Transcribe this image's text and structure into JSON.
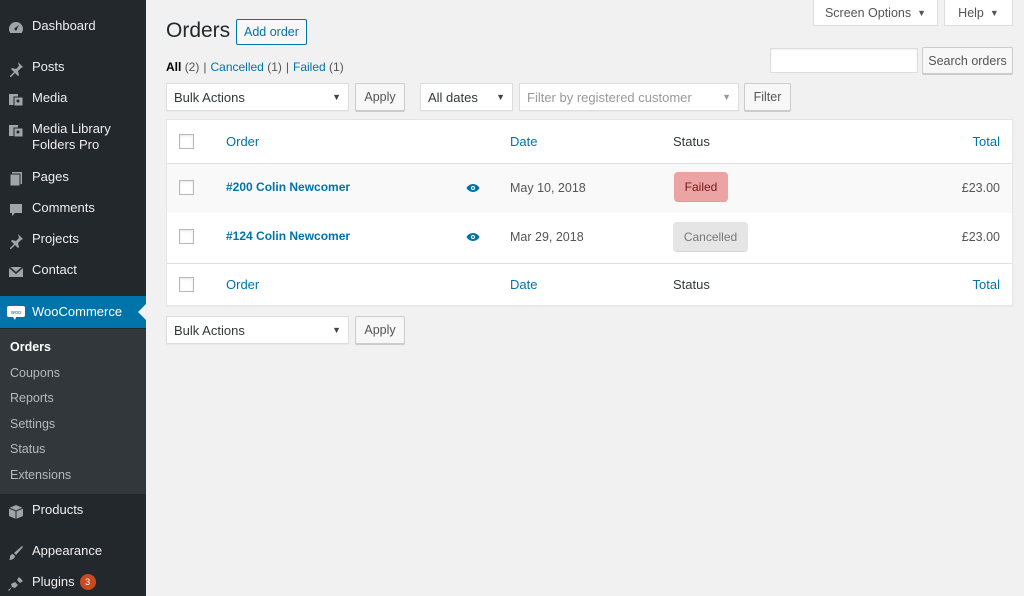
{
  "sidebar": {
    "items": [
      {
        "label": "Dashboard",
        "icon": "dashboard-icon"
      },
      {
        "label": "Posts",
        "icon": "pin-icon"
      },
      {
        "label": "Media",
        "icon": "media-icon"
      },
      {
        "label": "Media Library Folders Pro",
        "icon": "media-icon"
      },
      {
        "label": "Pages",
        "icon": "pages-icon"
      },
      {
        "label": "Comments",
        "icon": "comments-icon"
      },
      {
        "label": "Projects",
        "icon": "pin-icon"
      },
      {
        "label": "Contact",
        "icon": "envelope-icon"
      },
      {
        "label": "WooCommerce",
        "icon": "woo-icon",
        "active": true
      },
      {
        "label": "Products",
        "icon": "products-box-icon"
      },
      {
        "label": "Appearance",
        "icon": "brush-icon"
      },
      {
        "label": "Plugins",
        "icon": "plugin-icon",
        "badge": "3"
      }
    ],
    "submenu": [
      "Orders",
      "Coupons",
      "Reports",
      "Settings",
      "Status",
      "Extensions"
    ],
    "submenu_current": "Orders",
    "colors": {
      "bg": "#23282d",
      "submenu_bg": "#32373c",
      "active": "#0073aa"
    }
  },
  "top": {
    "screen_options": "Screen Options",
    "help": "Help"
  },
  "header": {
    "title": "Orders",
    "add_label": "Add order"
  },
  "views": {
    "all": {
      "label": "All",
      "count": "(2)"
    },
    "cancelled": {
      "label": "Cancelled",
      "count": "(1)"
    },
    "failed": {
      "label": "Failed",
      "count": "(1)"
    },
    "separator": "|"
  },
  "search": {
    "placeholder": "",
    "button": "Search orders"
  },
  "filters": {
    "bulk_actions": "Bulk Actions",
    "apply": "Apply",
    "dates": "All dates",
    "customer_placeholder": "Filter by registered customer",
    "filter": "Filter"
  },
  "table": {
    "columns": {
      "order": "Order",
      "date": "Date",
      "status": "Status",
      "total": "Total"
    },
    "rows": [
      {
        "order": "#200 Colin Newcomer",
        "date": "May 10, 2018",
        "status": "Failed",
        "total": "£23.00"
      },
      {
        "order": "#124 Colin Newcomer",
        "date": "Mar 29, 2018",
        "status": "Cancelled",
        "total": "£23.00"
      }
    ]
  },
  "bottom": {
    "bulk_actions": "Bulk Actions",
    "apply": "Apply"
  }
}
